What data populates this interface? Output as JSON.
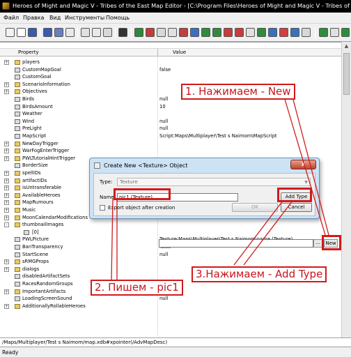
{
  "window": {
    "title": "Heroes of Might and Magic V - Tribes of the East Map Editor - [C:\\Program Files\\Heroes of Might and Magic V - Tribes of the East\\"
  },
  "menu": [
    "Файл",
    "Правка",
    "Вид",
    "Инструменты",
    "Помощь"
  ],
  "grid": {
    "col_property": "Property",
    "col_value": "Value",
    "rows": [
      {
        "name": "players",
        "value": "",
        "pm": "+",
        "icon": "folder"
      },
      {
        "name": "CustomMapGoal",
        "value": "false",
        "pm": "",
        "icon": "item"
      },
      {
        "name": "CustomGoal",
        "value": "",
        "pm": "",
        "icon": "item"
      },
      {
        "name": "ScenarioInformation",
        "value": "",
        "pm": "+",
        "icon": "folder"
      },
      {
        "name": "Objectives",
        "value": "",
        "pm": "+",
        "icon": "folder"
      },
      {
        "name": "Birds",
        "value": "null",
        "pm": "",
        "icon": "item"
      },
      {
        "name": "BirdsAmount",
        "value": "10",
        "pm": "",
        "icon": "item"
      },
      {
        "name": "Weather",
        "value": "",
        "pm": "",
        "icon": "item"
      },
      {
        "name": "Wind",
        "value": "null",
        "pm": "",
        "icon": "item"
      },
      {
        "name": "PreLight",
        "value": "null",
        "pm": "",
        "icon": "item"
      },
      {
        "name": "MapScript",
        "value": "Script:Maps\\Multiplayer\\Test s Naimom\\MapScript",
        "pm": "",
        "icon": "item"
      },
      {
        "name": "NewDayTrigger",
        "value": "",
        "pm": "+",
        "icon": "folder"
      },
      {
        "name": "WarFogEnterTrigger",
        "value": "",
        "pm": "+",
        "icon": "folder"
      },
      {
        "name": "PWLTutorialHintTrigger",
        "value": "",
        "pm": "+",
        "icon": "folder"
      },
      {
        "name": "BorderSize",
        "value": "",
        "pm": "",
        "icon": "item"
      },
      {
        "name": "spellIDs",
        "value": "",
        "pm": "+",
        "icon": "folder"
      },
      {
        "name": "artifactIDs",
        "value": "",
        "pm": "+",
        "icon": "folder"
      },
      {
        "name": "isUntransferable",
        "value": "",
        "pm": "+",
        "icon": "folder"
      },
      {
        "name": "AvailableHeroes",
        "value": "",
        "pm": "+",
        "icon": "folder"
      },
      {
        "name": "MapRumours",
        "value": "",
        "pm": "+",
        "icon": "folder"
      },
      {
        "name": "Music",
        "value": "",
        "pm": "+",
        "icon": "folder"
      },
      {
        "name": "MoonCalendarModifications",
        "value": "",
        "pm": "+",
        "icon": "folder"
      },
      {
        "name": "thumbnailImages",
        "value": "",
        "pm": "-",
        "icon": "folder"
      },
      {
        "name": "[0]",
        "value": "",
        "pm": "",
        "icon": "item",
        "indent": true
      },
      {
        "name": "PWLPicture",
        "value": "Texture:Maps\\Multiplayer\\Test s Naimom\\name.(Texture)",
        "pm": "",
        "icon": "item"
      },
      {
        "name": "BanTransparency",
        "value": "false",
        "pm": "",
        "icon": "item"
      },
      {
        "name": "StartScene",
        "value": "null",
        "pm": "",
        "icon": "item"
      },
      {
        "name": "sRMGProps",
        "value": "",
        "pm": "+",
        "icon": "folder"
      },
      {
        "name": "dialogs",
        "value": "",
        "pm": "+",
        "icon": "folder"
      },
      {
        "name": "disabledArtifactSets",
        "value": "",
        "pm": "",
        "icon": "item"
      },
      {
        "name": "RacesRandomGroups",
        "value": "",
        "pm": "",
        "icon": "item"
      },
      {
        "name": "ImportantArtifacts",
        "value": "",
        "pm": "+",
        "icon": "folder"
      },
      {
        "name": "LoadingScreenSound",
        "value": "null",
        "pm": "",
        "icon": "item"
      },
      {
        "name": "AdditionallyRollableHeroes",
        "value": "",
        "pm": "+",
        "icon": "folder"
      }
    ]
  },
  "inline_editor": {
    "dots_label": "...",
    "new_label": "New"
  },
  "dialog": {
    "title": "Create New <Texture> Object",
    "close": "x",
    "type_label": "Type:",
    "type_value": "Texture",
    "name_label": "Name:",
    "name_value": "pic1.(Texture)",
    "export_label": "Export object after creation",
    "add_type": "Add Type",
    "ok": "OK",
    "cancel": "Cancel"
  },
  "annotations": {
    "step1": "1. Нажимаем - New",
    "step2": "2. Пишем - pic1",
    "step3": "3.Нажимаем - Add Type",
    "color": "#d11a1a"
  },
  "path": "/Maps/Multiplayer/Test s Naimom/map.xdb#xpointer(/AdvMapDesc)",
  "status": "Ready"
}
